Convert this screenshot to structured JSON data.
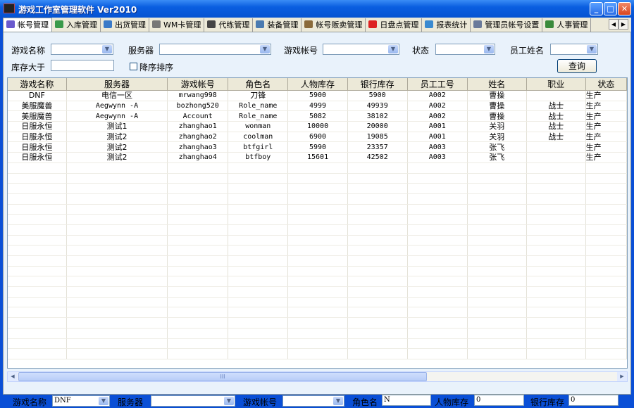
{
  "window": {
    "title": "游戏工作室管理软件 Ver2010",
    "minimize": "_",
    "maximize": "□",
    "close": "✕"
  },
  "tabs": [
    {
      "label": "帐号管理",
      "color": "#6a5acd"
    },
    {
      "label": "入库管理",
      "color": "#3a9a4a"
    },
    {
      "label": "出货管理",
      "color": "#3a7ac8"
    },
    {
      "label": "WM卡管理",
      "color": "#777"
    },
    {
      "label": "代练管理",
      "color": "#444"
    },
    {
      "label": "装备管理",
      "color": "#4a7ab0"
    },
    {
      "label": "帐号贩卖管理",
      "color": "#8a6a3a"
    },
    {
      "label": "日盘点管理",
      "color": "#d22"
    },
    {
      "label": "报表统计",
      "color": "#3a8ad0"
    },
    {
      "label": "管理员帐号设置",
      "color": "#6a7a9a"
    },
    {
      "label": "人事管理",
      "color": "#3a8a3a"
    }
  ],
  "tab_scroll": {
    "left": "◀",
    "right": "▶"
  },
  "filter": {
    "game_name": "游戏名称",
    "server": "服务器",
    "account": "游戏帐号",
    "status": "状态",
    "employee_name": "员工姓名",
    "stock_gt": "库存大于",
    "desc_sort": "降序排序",
    "query": "查询"
  },
  "table": {
    "columns": [
      "游戏名称",
      "服务器",
      "游戏帐号",
      "角色名",
      "人物库存",
      "银行库存",
      "员工工号",
      "姓名",
      "职业",
      "状态"
    ],
    "rows": [
      [
        "DNF",
        "电信一区",
        "mrwang998",
        "刀锋",
        "5900",
        "5900",
        "A002",
        "曹操",
        "",
        "生产"
      ],
      [
        "美服魔兽",
        "Aegwynn -A",
        "bozhong520",
        "Role_name",
        "4999",
        "49939",
        "A002",
        "曹操",
        "战士",
        "生产"
      ],
      [
        "美服魔兽",
        "Aegwynn -A",
        "Account",
        "Role_name",
        "5082",
        "38102",
        "A002",
        "曹操",
        "战士",
        "生产"
      ],
      [
        "日服永恒",
        "测试1",
        "zhanghao1",
        "wonman",
        "10000",
        "20000",
        "A001",
        "关羽",
        "战士",
        "生产"
      ],
      [
        "日服永恒",
        "测试2",
        "zhanghao2",
        "coolman",
        "6900",
        "19085",
        "A001",
        "关羽",
        "战士",
        "生产"
      ],
      [
        "日服永恒",
        "测试2",
        "zhanghao3",
        "btfgirl",
        "5990",
        "23357",
        "A003",
        "张飞",
        "",
        "生产"
      ],
      [
        "日服永恒",
        "测试2",
        "zhanghao4",
        "btfboy",
        "15601",
        "42502",
        "A003",
        "张飞",
        "",
        "生产"
      ]
    ]
  },
  "scrollbar": {
    "left": "◀",
    "right": "▶",
    "grip": "III"
  },
  "editor": {
    "game_name": "游戏名称",
    "game_name_value": "DNF",
    "server": "服务器",
    "account": "游戏帐号",
    "role": "角色名",
    "role_value": "N",
    "char_stock": "人物库存",
    "char_stock_value": "0",
    "bank_stock": "银行库存",
    "bank_stock_value": "0"
  }
}
